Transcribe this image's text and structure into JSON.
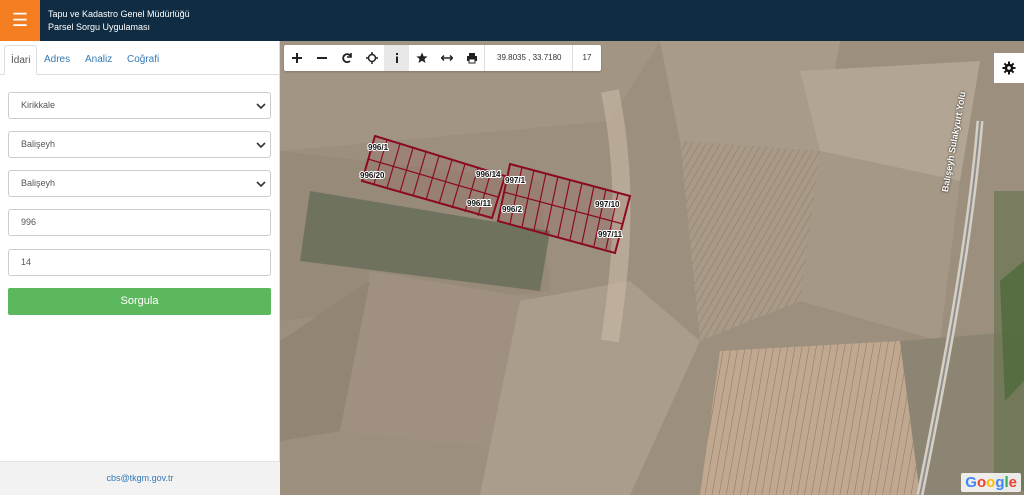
{
  "header": {
    "menu_icon": "hamburger-icon",
    "title_line1": "Tapu ve Kadastro Genel Müdürlüğü",
    "title_line2": "Parsel Sorgu Uygulaması",
    "bg_color": "#0f2c42",
    "accent_color": "#f47d21"
  },
  "sidebar": {
    "tabs": [
      "İdari",
      "Adres",
      "Analiz",
      "Coğrafi"
    ],
    "active_tab": "İdari",
    "province": "Kirikkale",
    "district": "Balişeyh",
    "neighborhood": "Balişeyh",
    "block_no": "996",
    "parcel_no": "14",
    "query_button": "Sorgula",
    "query_button_color": "#5cb85c",
    "footer_email": "cbs@tkgm.gov.tr"
  },
  "map": {
    "coordinates": "39.8035 , 33.7180",
    "zoom_level": "17",
    "road_label": "Balışeyh Sulakyurt Yolu",
    "attribution": "Google",
    "parcel_labels": [
      "996/1",
      "996/2",
      "996/11",
      "996/20",
      "996/14",
      "997/10",
      "997/11",
      "997/1"
    ],
    "parcel_color": "#8b0a22"
  }
}
